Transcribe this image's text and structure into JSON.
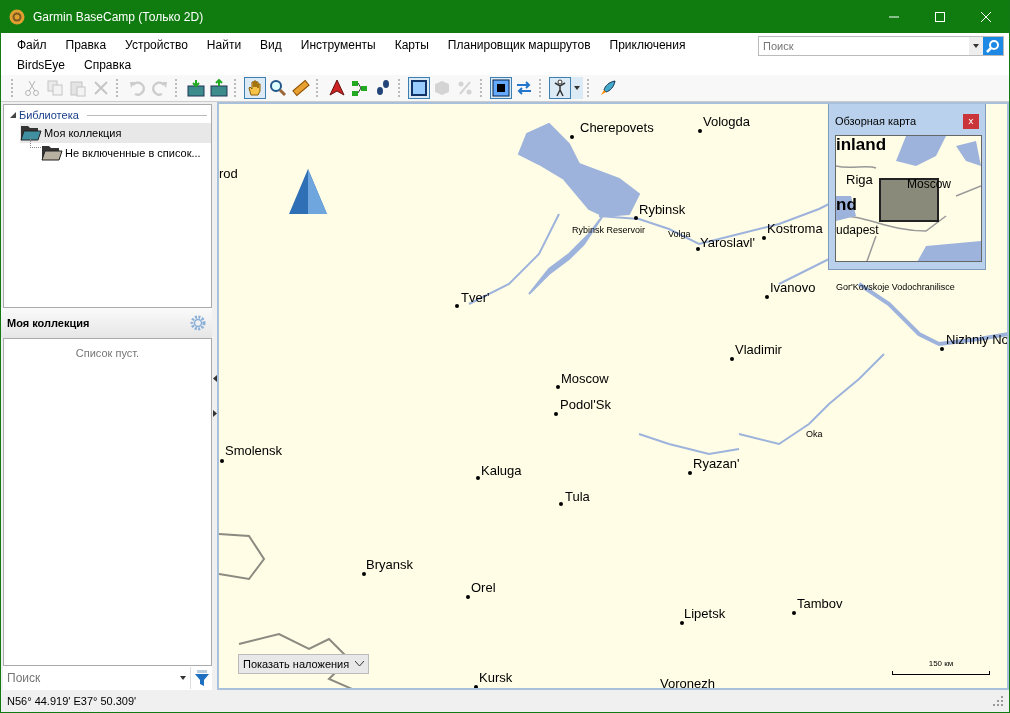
{
  "window": {
    "title": "Garmin BaseCamp (Только 2D)"
  },
  "menu": [
    "Файл",
    "Правка",
    "Устройство",
    "Найти",
    "Вид",
    "Инструменты",
    "Карты",
    "Планировщик маршрутов",
    "Приключения",
    "BirdsEye",
    "Справка"
  ],
  "search": {
    "placeholder": "Поиск"
  },
  "toolbar": [
    {
      "selected": false,
      "disabled": true
    },
    {
      "selected": false,
      "disabled": true
    },
    {
      "selected": false,
      "disabled": true
    },
    {
      "selected": false,
      "disabled": true
    },
    {
      "selected": false,
      "disabled": true
    },
    {
      "selected": false,
      "disabled": true
    },
    {
      "selected": false,
      "disabled": false
    },
    {
      "selected": false,
      "disabled": false
    },
    {
      "selected": true,
      "disabled": false
    },
    {
      "selected": false,
      "disabled": false
    },
    {
      "selected": false,
      "disabled": false
    },
    {
      "selected": false,
      "disabled": false
    },
    {
      "selected": false,
      "disabled": false
    },
    {
      "selected": false,
      "disabled": false
    },
    {
      "selected": true,
      "disabled": false
    },
    {
      "selected": false,
      "disabled": true
    },
    {
      "selected": false,
      "disabled": true
    },
    {
      "selected": true,
      "disabled": false
    },
    {
      "selected": false,
      "disabled": false
    },
    {
      "selected": true,
      "disabled": false
    },
    {
      "selected": false,
      "disabled": false
    }
  ],
  "library": {
    "title": "Библиотека",
    "expanded": true,
    "items": [
      {
        "label": "Моя коллекция",
        "selected": true,
        "children": [
          {
            "label": "Не включенные в список...",
            "selected": false
          }
        ]
      }
    ]
  },
  "collection": {
    "title": "Моя коллекция",
    "empty_text": "Список пуст."
  },
  "list_search": {
    "placeholder": "Поиск"
  },
  "map": {
    "overlay_button": "Показать наложения",
    "scale": "150 км",
    "places": [
      {
        "kind": "city",
        "name": "Cherepovets"
      },
      {
        "kind": "city",
        "name": "Vologda"
      },
      {
        "kind": "label",
        "name": "rod"
      },
      {
        "kind": "city",
        "name": "Rybinsk"
      },
      {
        "kind": "water",
        "name": "Rybinsk Reservoir"
      },
      {
        "kind": "water",
        "name": "Volga"
      },
      {
        "kind": "city",
        "name": "Yaroslavl'"
      },
      {
        "kind": "city",
        "name": "Kostroma"
      },
      {
        "kind": "city",
        "name": "Tver'"
      },
      {
        "kind": "city",
        "name": "Ivanovo"
      },
      {
        "kind": "water",
        "name": "Gor'Kovskoje Vodochranilisce"
      },
      {
        "kind": "city",
        "name": "Nizhniy No"
      },
      {
        "kind": "city",
        "name": "Vladimir"
      },
      {
        "kind": "city",
        "name": "Moscow"
      },
      {
        "kind": "city",
        "name": "Podol'Sk"
      },
      {
        "kind": "water",
        "name": "Oka"
      },
      {
        "kind": "city",
        "name": "Smolensk"
      },
      {
        "kind": "city",
        "name": "Ryazan'"
      },
      {
        "kind": "city",
        "name": "Kaluga"
      },
      {
        "kind": "city",
        "name": "Tula"
      },
      {
        "kind": "city",
        "name": "Bryansk"
      },
      {
        "kind": "city",
        "name": "Orel"
      },
      {
        "kind": "city",
        "name": "Tambov"
      },
      {
        "kind": "city",
        "name": "Lipetsk"
      },
      {
        "kind": "city",
        "name": "Kursk"
      },
      {
        "kind": "city",
        "name": "Voronezh"
      }
    ]
  },
  "overview": {
    "title": "Обзорная карта",
    "close": "x",
    "labels": [
      "inland",
      "Riga",
      "nd",
      "Moscow",
      "udapest"
    ]
  },
  "status_bar": {
    "coordinates": "N56° 44.919' E37° 50.309'"
  }
}
